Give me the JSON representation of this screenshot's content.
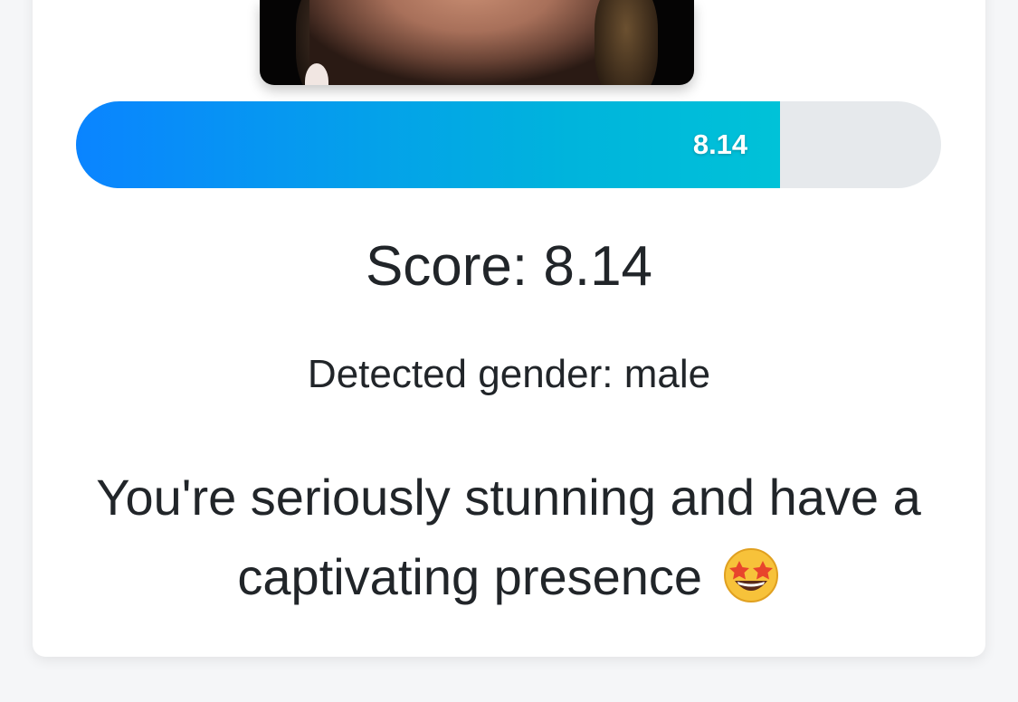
{
  "result": {
    "photo_alt": "face-photo",
    "progress": {
      "value": 8.14,
      "max": 10,
      "fraction": 0.814,
      "label": "8.14"
    },
    "score_text": "Score: 8.14",
    "gender_text": "Detected gender: male",
    "message": "You're seriously stunning and have a captivating presence",
    "emoji_icon": "star-struck-emoji"
  },
  "colors": {
    "background": "#f5f6f8",
    "card": "#ffffff",
    "progress_track": "#e6e9ec",
    "progress_start": "#0a84ff",
    "progress_end": "#00c2d8",
    "text": "#212529"
  }
}
